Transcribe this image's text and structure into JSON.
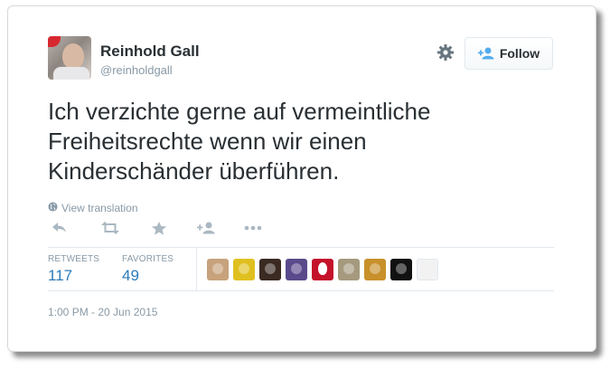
{
  "author": {
    "name": "Reinhold Gall",
    "handle": "@reinholdgall"
  },
  "follow_button": {
    "label": "Follow"
  },
  "tweet": {
    "text": "Ich verzichte gerne auf vermeintliche\nFreiheitsrechte wenn wir einen\nKinderschänder überführen.",
    "translate_label": "View translation",
    "timestamp": "1:00 PM - 20 Jun 2015"
  },
  "stats": {
    "retweets_label": "RETWEETS",
    "retweets_value": "117",
    "favorites_label": "FAVORITES",
    "favorites_value": "49"
  },
  "actions": [
    "reply-icon",
    "retweet-icon",
    "favorite-icon",
    "follow-icon",
    "more-icon"
  ],
  "favoriters": [
    {
      "name": "favoriter-avatar-1",
      "color": "#c7a27c"
    },
    {
      "name": "favoriter-avatar-2",
      "color": "#e0c020"
    },
    {
      "name": "favoriter-avatar-3",
      "color": "#3a2a22"
    },
    {
      "name": "favoriter-avatar-4",
      "color": "#5a4a8c"
    },
    {
      "name": "favoriter-avatar-5",
      "color": "#c4122a"
    },
    {
      "name": "favoriter-avatar-6",
      "color": "#a59a7e"
    },
    {
      "name": "favoriter-avatar-7",
      "color": "#c8902a"
    },
    {
      "name": "favoriter-avatar-8",
      "color": "#111111"
    },
    {
      "name": "favoriter-avatar-9",
      "color": "#f2f2f2"
    }
  ],
  "colors": {
    "link": "#2b7bb9",
    "muted": "#8899a6",
    "text": "#292f33",
    "follow_icon": "#55acee"
  }
}
